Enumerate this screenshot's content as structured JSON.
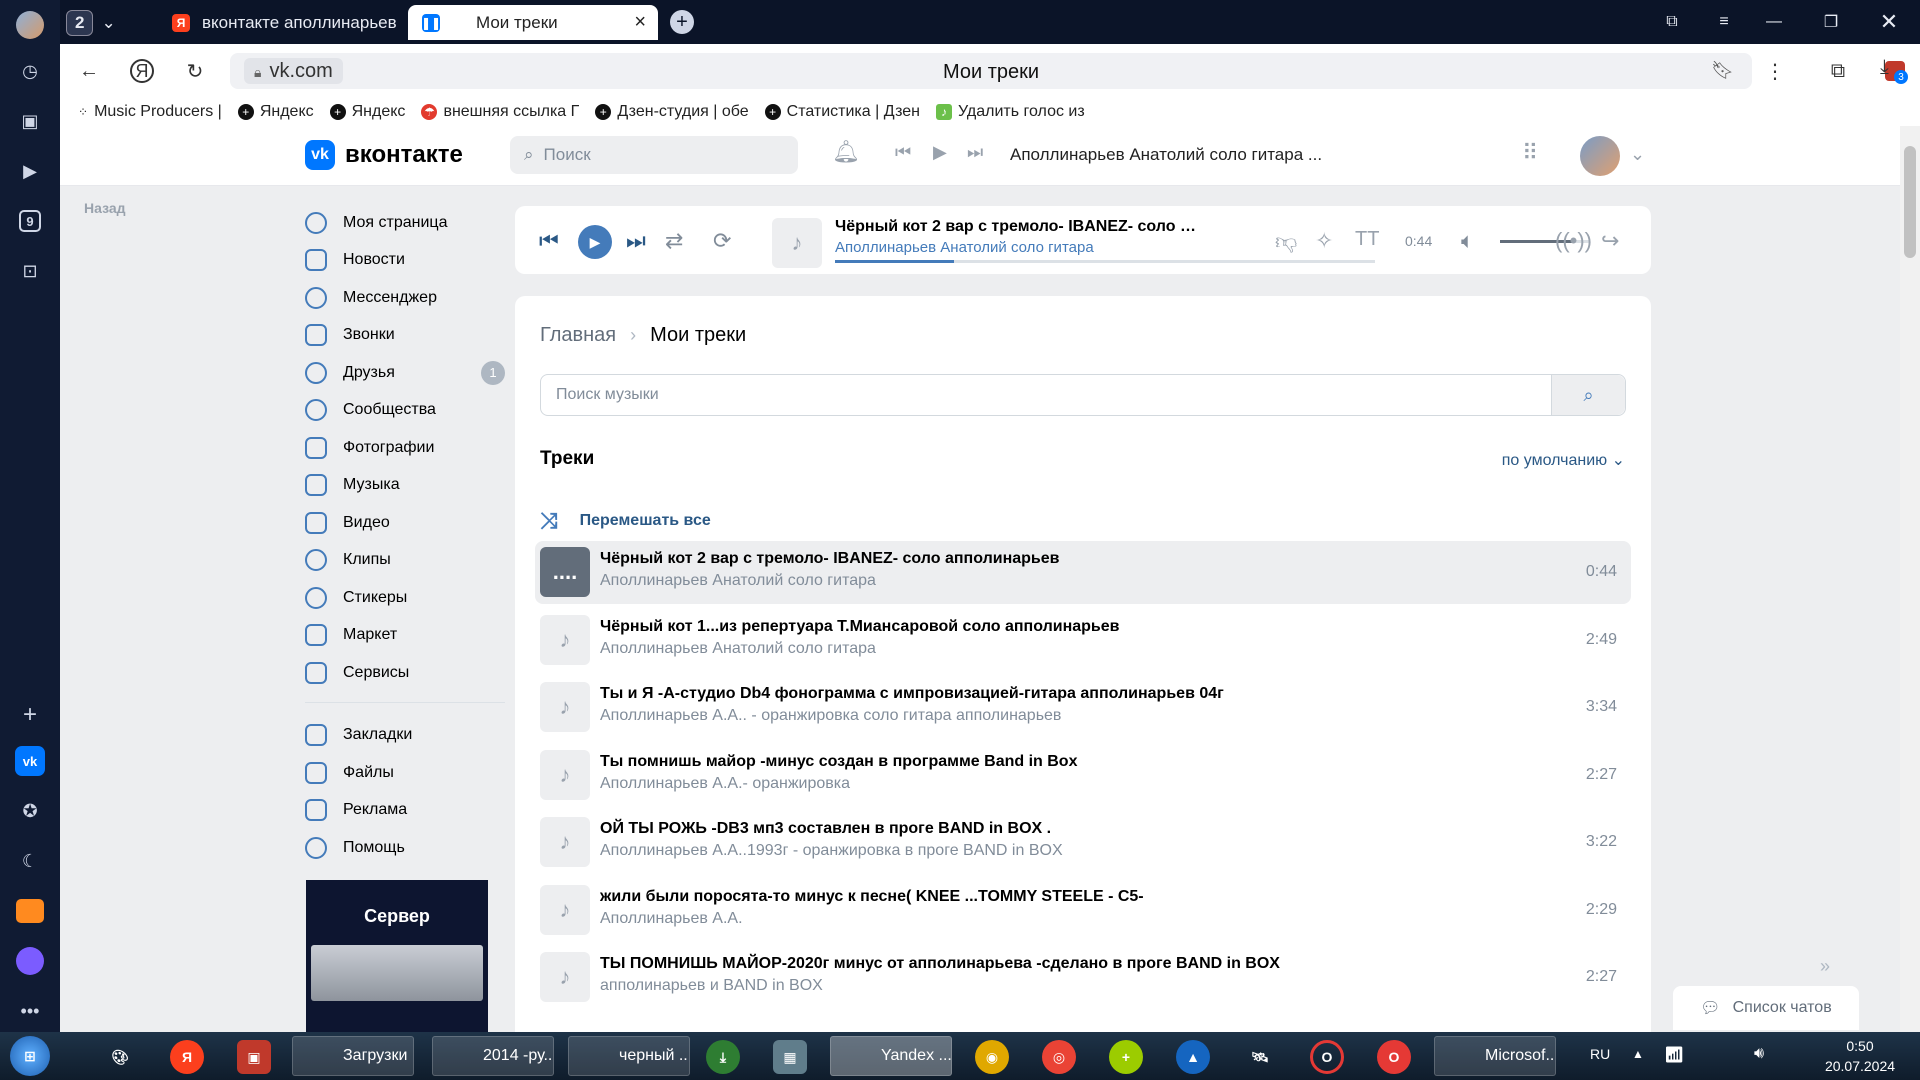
{
  "browser": {
    "tab_count": "2",
    "tabs": [
      {
        "label": "вконтакте аполлинарьев",
        "active": false
      },
      {
        "label": "Мои треки",
        "active": true
      }
    ],
    "url_domain": "vk.com",
    "page_title": "Мои треки",
    "download_badge": "3"
  },
  "bookmarks": [
    "Music Producers |",
    "Яндекс",
    "Яндекс",
    "внешняя ссылка Г",
    "Дзен-студия | обе",
    "Статистика | Дзен",
    "Удалить голос из"
  ],
  "side_panel": {
    "badge_nine": "9"
  },
  "vk_header": {
    "logo_text": "вконтакте",
    "search_placeholder": "Поиск",
    "now_playing": "Аполлинарьев Анатолий соло гитара ..."
  },
  "back_label": "Назад",
  "left_nav": {
    "items": [
      {
        "label": "Моя страница"
      },
      {
        "label": "Новости"
      },
      {
        "label": "Мессенджер"
      },
      {
        "label": "Звонки"
      },
      {
        "label": "Друзья",
        "badge": "1"
      },
      {
        "label": "Сообщества"
      },
      {
        "label": "Фотографии"
      },
      {
        "label": "Музыка"
      },
      {
        "label": "Видео"
      },
      {
        "label": "Клипы"
      },
      {
        "label": "Стикеры"
      },
      {
        "label": "Маркет"
      },
      {
        "label": "Сервисы"
      }
    ],
    "secondary": [
      {
        "label": "Закладки"
      },
      {
        "label": "Файлы"
      },
      {
        "label": "Реклама"
      },
      {
        "label": "Помощь"
      }
    ],
    "ad_title": "Сервер"
  },
  "player": {
    "title": "Чёрный кот 2 вар с тремоло- IBANEZ- соло апполинарьев",
    "artist": "Аполлинарьев Анатолий соло гитара",
    "time": "0:44",
    "progress": 0.22,
    "volume": 0.8
  },
  "main": {
    "breadcrumb_home": "Главная",
    "breadcrumb_current": "Мои треки",
    "search_placeholder": "Поиск музыки",
    "tracks_heading": "Треки",
    "sort_label": "по умолчанию",
    "shuffle_label": "Перемешать все",
    "tracks": [
      {
        "title": "Чёрный кот 2 вар с тремоло- IBANEZ- соло апполинарьев",
        "artist": "Аполлинарьев Анатолий соло гитара",
        "duration": "0:44",
        "current": true
      },
      {
        "title": "Чёрный кот 1...из репертуара Т.Миансаровой соло апполинарьев",
        "artist": "Аполлинарьев Анатолий соло гитара",
        "duration": "2:49"
      },
      {
        "title": "Ты и Я -А-студио Db4 фонограмма с импровизацией-гитара апполинарьев 04г",
        "artist": "Аполлинарьев А.А.. - оранжировка соло гитара апполинарьев",
        "duration": "3:34"
      },
      {
        "title": "Ты помнишь майор -минус создан в программе Band in Box",
        "artist": "Аполлинарьев А.А.- оранжировка",
        "duration": "2:27"
      },
      {
        "title": "ОЙ ТЫ РОЖЬ -DB3 мп3 составлен в проге BAND in BOX .",
        "artist": "Аполлинарьев А.А..1993г - оранжировка в проге BAND in BOX",
        "duration": "3:22"
      },
      {
        "title": "жили были поросята-то минус к песне( KNEE ...TOMMY STEELE - C5-",
        "artist": "Аполлинарьев А.А.",
        "duration": "2:29"
      },
      {
        "title": "ТЫ ПОМНИШЬ МАЙОР-2020г минус от апполинарьева -сделано в проге BAND in BOX",
        "artist": "апполинарьев и BAND in BOX",
        "duration": "2:27"
      }
    ]
  },
  "chat_list_label": "Список чатов",
  "taskbar": {
    "tasks": [
      {
        "label": "Загрузки"
      },
      {
        "label": "2014 -ру..."
      },
      {
        "label": "черный ..."
      },
      {
        "label": "Yandex ...",
        "active": true
      },
      {
        "label": "Microsof..."
      }
    ],
    "lang": "RU",
    "time": "0:50",
    "date": "20.07.2024"
  },
  "colors": {
    "vk_blue": "#0077ff",
    "link": "#2a5885",
    "accent": "#447bba",
    "page_bg": "#edeef0"
  }
}
